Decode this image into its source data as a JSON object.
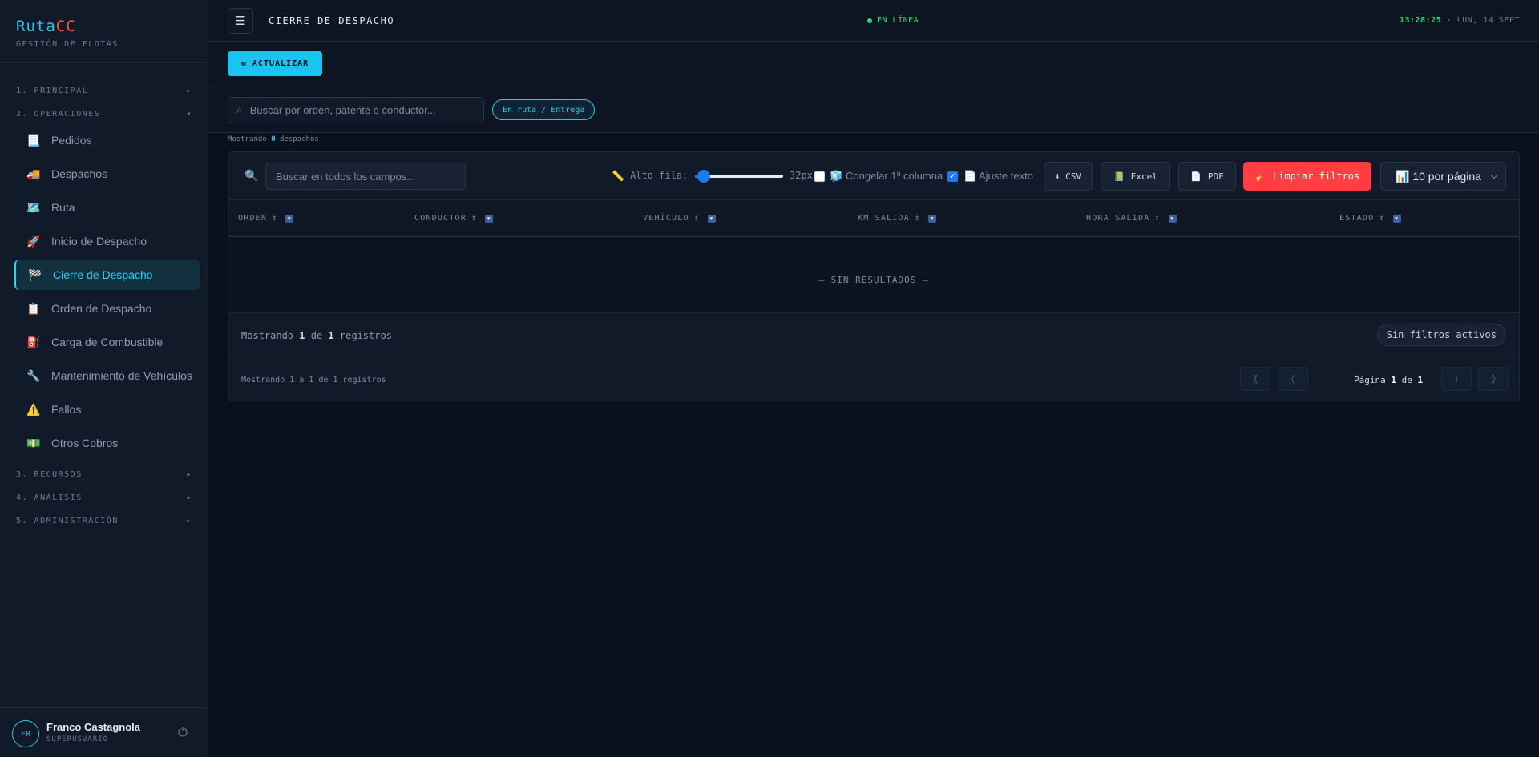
{
  "brand": {
    "name_a": "Ruta",
    "name_b": "CC",
    "subtitle": "GESTIÓN DE FLOTAS"
  },
  "sidebar": {
    "sections": [
      {
        "label": "1. PRINCIPAL",
        "arrow": "▸"
      },
      {
        "label": "2. OPERACIONES",
        "arrow": "▾"
      },
      {
        "label": "3. RECURSOS",
        "arrow": "▸"
      },
      {
        "label": "4. ANÁLISIS",
        "arrow": "▸"
      },
      {
        "label": "5. ADMINISTRACIÓN",
        "arrow": "▸"
      }
    ],
    "items": [
      {
        "label": "Pedidos",
        "icon": "📃"
      },
      {
        "label": "Despachos",
        "icon": "🚚"
      },
      {
        "label": "Ruta",
        "icon": "🗺️"
      },
      {
        "label": "Inicio de Despacho",
        "icon": "🚀"
      },
      {
        "label": "Cierre de Despacho",
        "icon": "🏁"
      },
      {
        "label": "Orden de Despacho",
        "icon": "📋"
      },
      {
        "label": "Carga de Combustible",
        "icon": "⛽"
      },
      {
        "label": "Mantenimiento de Vehículos",
        "icon": "🔧"
      },
      {
        "label": "Fallos",
        "icon": "⚠️"
      },
      {
        "label": "Otros Cobros",
        "icon": "💵"
      }
    ],
    "active_index": 4
  },
  "user": {
    "initials": "FR",
    "name": "Franco Castagnola",
    "role": "SUPERUSUARIO",
    "power_icon": "⏻"
  },
  "topbar": {
    "menu_icon": "☰",
    "title": "CIERRE DE DESPACHO",
    "status": "EN LÍNEA",
    "time": "13:28:25",
    "date": "· LUN, 14 SEPT"
  },
  "actions": {
    "refresh_label": "↻ ACTUALIZAR"
  },
  "filters": {
    "search_placeholder": "Buscar por orden, patente o conductor...",
    "search_icon": "⌕",
    "chip": "En ruta / Entrega",
    "count_prefix": "Mostrando",
    "count_value": "0",
    "count_suffix": "despachos"
  },
  "table": {
    "search_icon": "🔍",
    "search_placeholder": "Buscar en todos los campos...",
    "row_height_icon": "📏",
    "row_height_label": "Alto fila:",
    "row_height_value": "32px",
    "row_height_fraction": 0.1,
    "freeze_icon": "🧊",
    "freeze_label": "Congelar 1ª columna",
    "freeze_checked": false,
    "wrap_icon": "📄",
    "wrap_label": "Ajuste texto",
    "wrap_checked": true,
    "csv_label": "⬇ CSV",
    "excel_label": "Excel",
    "excel_icon": "📗",
    "pdf_label": "PDF",
    "pdf_icon": "📄",
    "clear_label": "🧹 Limpiar filtros",
    "page_size_label": "📊 10 por página",
    "columns": [
      "ORDEN",
      "CONDUCTOR",
      "VEHÍCULO",
      "KM SALIDA",
      "HORA SALIDA",
      "ESTADO"
    ],
    "sort_icon": "↕",
    "filter_icon": "▼",
    "empty": "— SIN RESULTADOS —"
  },
  "footer": {
    "summary_a": "Mostrando",
    "summary_n1": "1",
    "summary_b": "de",
    "summary_n2": "1",
    "summary_c": "registros",
    "no_filters": "Sin filtros activos",
    "range_text": "Mostrando 1 a 1 de 1 registros",
    "page_a": "Página",
    "page_n": "1",
    "page_b": "de",
    "page_total": "1",
    "first": "⟪",
    "prev": "⟨",
    "next": "⟩",
    "last": "⟫"
  }
}
